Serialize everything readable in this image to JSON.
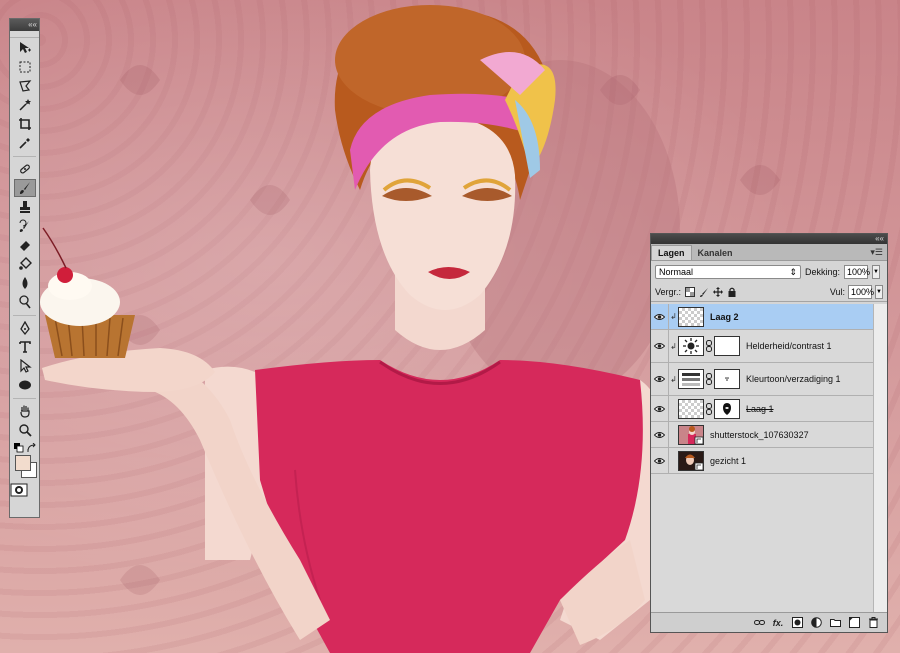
{
  "colors": {
    "foreground_swatch": "#f2dccd",
    "background_swatch": "#ffffff",
    "selected_layer": "#a9cdf3"
  },
  "canvas": {
    "content": "photo-of-woman-holding-cupcake"
  },
  "toolbox": {
    "collapse_label": "««",
    "tools": [
      {
        "icon": "move-tool-icon"
      },
      {
        "icon": "marquee-tool-icon"
      },
      {
        "icon": "lasso-tool-icon"
      },
      {
        "icon": "quick-selection-tool-icon"
      },
      {
        "icon": "crop-tool-icon"
      },
      {
        "icon": "eyedropper-tool-icon"
      },
      {
        "icon": "healing-brush-tool-icon"
      },
      {
        "icon": "brush-tool-icon",
        "selected": true
      },
      {
        "icon": "clone-stamp-tool-icon"
      },
      {
        "icon": "history-brush-tool-icon"
      },
      {
        "icon": "eraser-tool-icon"
      },
      {
        "icon": "paint-bucket-tool-icon"
      },
      {
        "icon": "blur-tool-icon"
      },
      {
        "icon": "dodge-tool-icon"
      },
      {
        "icon": "pen-tool-icon"
      },
      {
        "icon": "type-tool-icon"
      },
      {
        "icon": "path-selection-tool-icon"
      },
      {
        "icon": "ellipse-tool-icon"
      },
      {
        "icon": "hand-tool-icon"
      },
      {
        "icon": "zoom-tool-icon"
      }
    ]
  },
  "layers_panel": {
    "collapse_label": "««",
    "tabs": [
      {
        "label": "Lagen",
        "active": true
      },
      {
        "label": "Kanalen",
        "active": false
      }
    ],
    "menu_icon": "panel-menu-icon",
    "blend_mode": "Normaal",
    "opacity_label": "Dekking:",
    "opacity_value": "100%",
    "lock_label": "Vergr.:",
    "fill_label": "Vul:",
    "fill_value": "100%",
    "layers": [
      {
        "name": "Laag 2",
        "selected": true,
        "clipped": true,
        "thumb": "transparent"
      },
      {
        "name": "Helderheid/contrast 1",
        "selected": false,
        "clipped": true,
        "thumb": "brightness-adjustment-icon",
        "mask": "white"
      },
      {
        "name": "Kleurtoon/verzadiging 1",
        "selected": false,
        "clipped": true,
        "thumb": "hue-saturation-adjustment-icon",
        "mask": "white"
      },
      {
        "name": "Laag 1",
        "selected": false,
        "clipped": false,
        "thumb": "transparent",
        "mask": "silhouette",
        "strike": true
      },
      {
        "name": "shutterstock_107630327",
        "selected": false,
        "clipped": false,
        "thumb": "photo",
        "smart": true
      },
      {
        "name": "gezicht 1",
        "selected": false,
        "clipped": false,
        "thumb": "photo-face",
        "smart": true
      }
    ],
    "footer_icons": [
      "link-layers-icon",
      "fx-icon",
      "add-mask-icon",
      "adjustment-layer-icon",
      "group-folder-icon",
      "new-layer-icon",
      "delete-layer-icon"
    ],
    "footer_fx_label": "fx."
  }
}
